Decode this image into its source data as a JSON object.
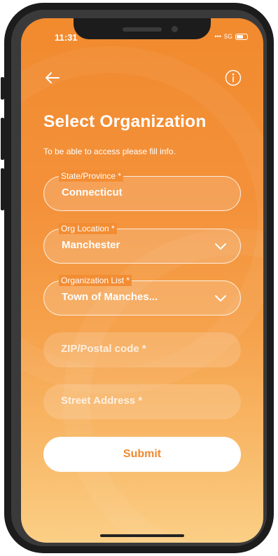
{
  "status_bar": {
    "time": "11:31",
    "network": "5G"
  },
  "header": {
    "back_icon": "arrow-left-icon",
    "info_icon": "info-circle-icon"
  },
  "page": {
    "title": "Select Organization",
    "subtitle": "To be able to access please fill info."
  },
  "form": {
    "state": {
      "label": "State/Province *",
      "value": "Connecticut"
    },
    "org_location": {
      "label": "Org Location *",
      "value": "Manchester"
    },
    "org_list": {
      "label": "Organization List *",
      "value": "Town of Manches..."
    },
    "zip": {
      "placeholder": "ZIP/Postal code *"
    },
    "street": {
      "placeholder": "Street Address *"
    },
    "submit_label": "Submit"
  },
  "colors": {
    "accent": "#f28a2e",
    "button_text": "#ef8a30",
    "gradient_bottom": "#fbcf86"
  }
}
